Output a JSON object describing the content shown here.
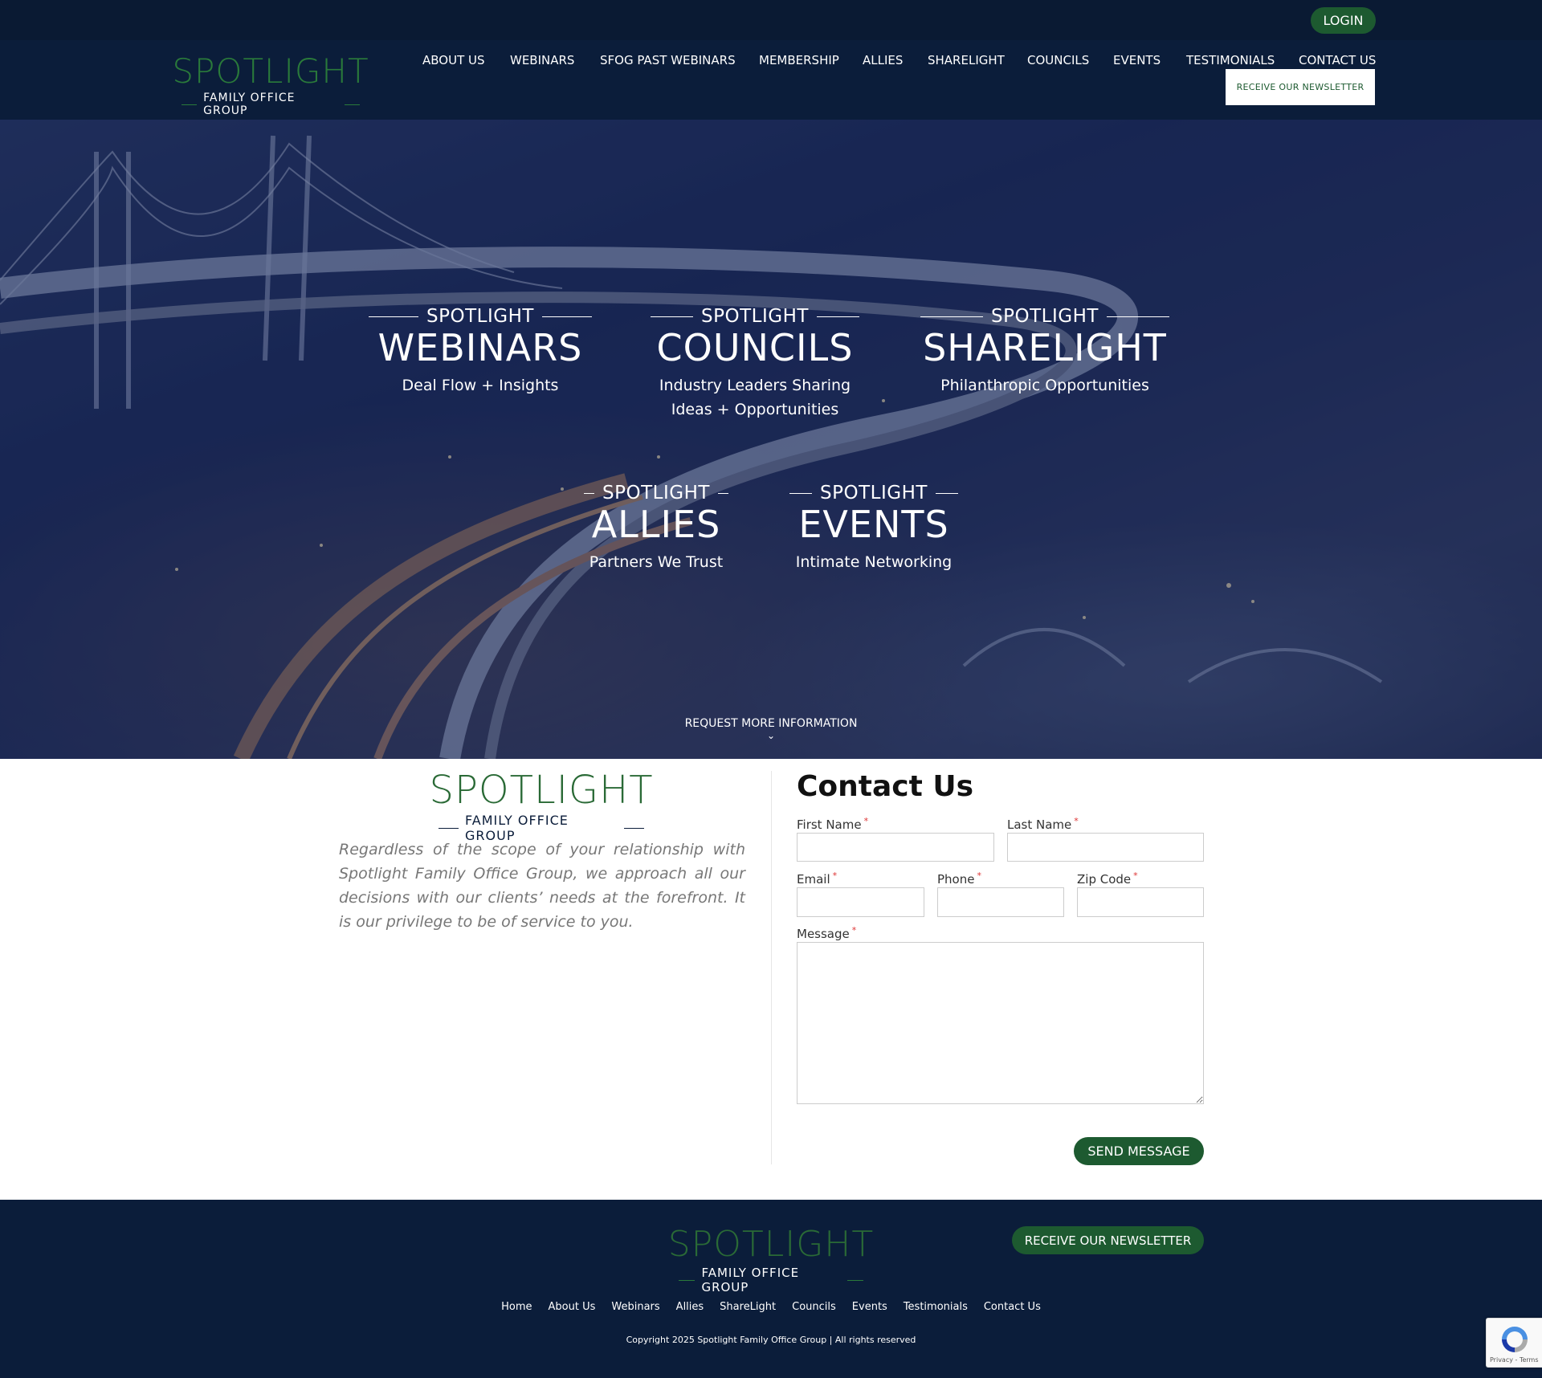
{
  "header": {
    "login_label": "LOGIN",
    "logo_word": "SPOTLIGHT",
    "logo_sub": "FAMILY OFFICE GROUP",
    "nav": [
      "ABOUT US",
      "WEBINARS",
      "SFOG PAST WEBINARS",
      "MEMBERSHIP",
      "ALLIES",
      "SHARELIGHT",
      "COUNCILS",
      "EVENTS",
      "TESTIMONIALS",
      "CONTACT US"
    ],
    "newsletter_label": "RECEIVE OUR NEWSLETTER"
  },
  "hero": {
    "features": [
      {
        "eyebrow": "SPOTLIGHT",
        "title": "WEBINARS",
        "desc": "Deal Flow + Insights"
      },
      {
        "eyebrow": "SPOTLIGHT",
        "title": "COUNCILS",
        "desc": "Industry Leaders Sharing Ideas + Opportunities"
      },
      {
        "eyebrow": "SPOTLIGHT",
        "title": "SHARELIGHT",
        "desc": "Philanthropic Opportunities"
      },
      {
        "eyebrow": "SPOTLIGHT",
        "title": "ALLIES",
        "desc": "Partners We Trust"
      },
      {
        "eyebrow": "SPOTLIGHT",
        "title": "EVENTS",
        "desc": "Intimate Networking"
      }
    ],
    "request_label": "REQUEST MORE INFORMATION",
    "chevron_icon": "chevron-down-icon"
  },
  "contact": {
    "logo_word": "SPOTLIGHT",
    "logo_sub": "FAMILY OFFICE GROUP",
    "about": "Regardless of the scope of your relationship with Spotlight Family Office Group, we approach all our decisions with our clients’ needs at the forefront. It is our privilege to be of service to you.",
    "form_title": "Contact Us",
    "fields": {
      "first_name": {
        "label": "First Name",
        "required": "*",
        "value": ""
      },
      "last_name": {
        "label": "Last Name",
        "required": "*",
        "value": ""
      },
      "email": {
        "label": "Email",
        "required": "*",
        "value": ""
      },
      "phone": {
        "label": "Phone",
        "required": "*",
        "value": ""
      },
      "zip": {
        "label": "Zip Code",
        "required": "*",
        "value": ""
      },
      "message": {
        "label": "Message",
        "required": "*",
        "value": ""
      }
    },
    "send_label": "SEND MESSAGE"
  },
  "footer": {
    "logo_word": "SPOTLIGHT",
    "logo_sub": "FAMILY OFFICE GROUP",
    "newsletter_label": "RECEIVE OUR NEWSLETTER",
    "links": [
      "Home",
      "About Us",
      "Webinars",
      "Allies",
      "ShareLight",
      "Councils",
      "Events",
      "Testimonials",
      "Contact Us"
    ],
    "copyright": "Copyright 2025 Spotlight Family Office Group | All rights reserved"
  },
  "recaptcha": {
    "label": "Privacy - Terms"
  },
  "colors": {
    "navy": "#0b1d3a",
    "green": "#1d5a30",
    "logo_green": "#2a7a3a"
  }
}
